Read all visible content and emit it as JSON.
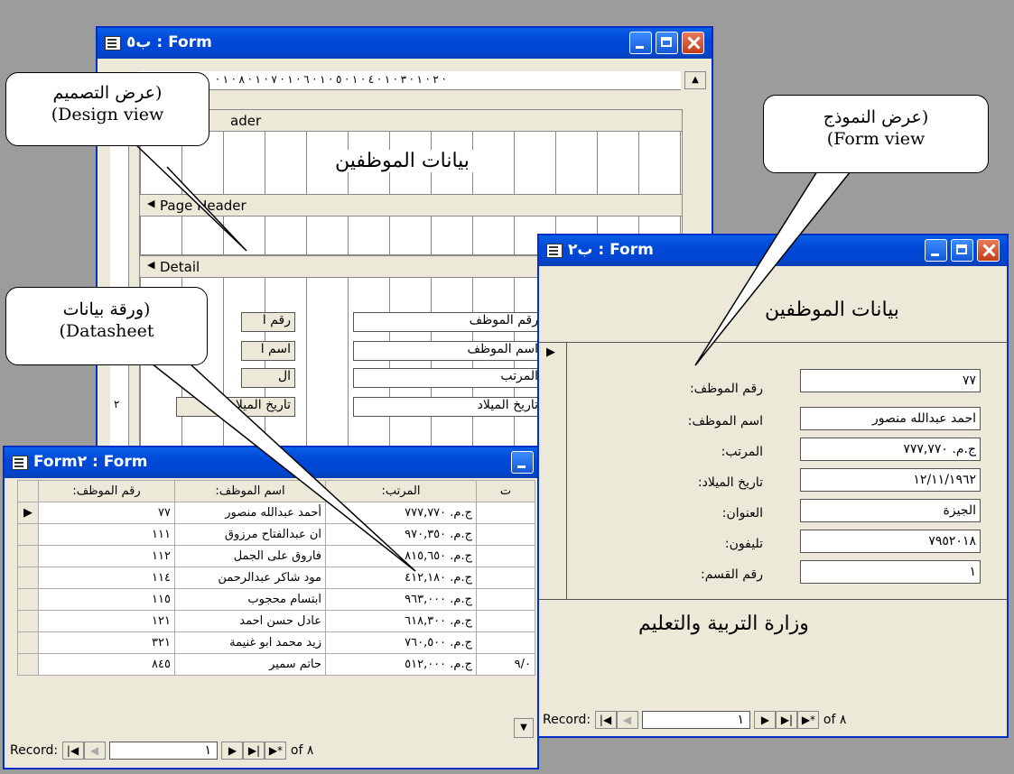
{
  "design_window": {
    "title": "ب٥ : Form",
    "ruler": "· ٢ · ١ · ٣ · ١ · ٤ · ١ · ٥ · ١ · ٦ · ١ · ٧ · ١ · ٨ · ١ ·",
    "section_report_header": "ader",
    "heading": "بيانات الموظفين",
    "section_page_header": "Page Header",
    "section_detail": "Detail",
    "rows": [
      {
        "label": "رقم ا",
        "field": "رقم الموظف"
      },
      {
        "label": "اسم ا",
        "field": "اسم الموظف"
      },
      {
        "label": "ال",
        "field": "المرتب"
      },
      {
        "label": "تاريخ الميلاد:",
        "field": "تاريخ الميلاد"
      }
    ],
    "vruler_digit": "٢"
  },
  "form_window": {
    "title": "ب٢ : Form",
    "heading": "بيانات الموظفين",
    "fields": [
      {
        "label": "رقم الموظف:",
        "value": "٧٧"
      },
      {
        "label": "اسم الموظف:",
        "value": "احمد عبدالله منصور"
      },
      {
        "label": "المرتب:",
        "value": "ج.م. ٧٧٧,٧٧٠"
      },
      {
        "label": "تاريخ الميلاد:",
        "value": "١٢/١١/١٩٦٢"
      },
      {
        "label": "العنوان:",
        "value": "الجيزة"
      },
      {
        "label": "تليفون:",
        "value": "٧٩٥٢٠١٨"
      },
      {
        "label": "رقم القسم:",
        "value": "١"
      }
    ],
    "footer": "وزارة التربية والتعليم",
    "nav": {
      "label": "Record:",
      "current": "١",
      "of": "of ٨"
    }
  },
  "datasheet_window": {
    "title": "Form٢ : Form",
    "headers": [
      "رقم الموظف:",
      "اسم الموظف:",
      "المرتب:",
      "ت"
    ],
    "rows": [
      [
        "٧٧",
        "أحمد عبدالله منصور",
        "ج.م. ٧٧٧,٧٧٠",
        ""
      ],
      [
        "١١١",
        "ان عبدالفتاح مرزوق",
        "ج.م. ٩٧٠,٣٥٠",
        ""
      ],
      [
        "١١٢",
        "فاروق على الجمل",
        "ج.م. ٨١٥,٦٥٠",
        ""
      ],
      [
        "١١٤",
        "مود شاكر عبدالرحمن",
        "ج.م. ٤١٢,١٨٠",
        ""
      ],
      [
        "١١٥",
        "ابتسام محجوب",
        "ج.م. ٩٦٣,٠٠٠",
        ""
      ],
      [
        "١٢١",
        "عادل حسن احمد",
        "ج.م. ٦١٨,٣٠٠",
        ""
      ],
      [
        "٣٢١",
        "زيد محمد ابو غنيمة",
        "ج.م. ٧٦٠,٥٠٠",
        ""
      ],
      [
        "٨٤٥",
        "حاتم سمير",
        "ج.م. ٥١٢,٠٠٠",
        "٩/٠"
      ]
    ],
    "nav": {
      "label": "Record:",
      "current": "١",
      "of": "of ٨"
    }
  },
  "callouts": {
    "design": {
      "arabic": "(عرض التصميم",
      "english": "(Design view"
    },
    "form": {
      "arabic": "(عرض النموذج",
      "english": "(Form view"
    },
    "datasheet": {
      "arabic": "(ورقة بيانات",
      "english": "(Datasheet"
    }
  },
  "colors": {
    "titlebar": "#0054e3",
    "face": "#ece9d8",
    "close": "#d9552e"
  }
}
